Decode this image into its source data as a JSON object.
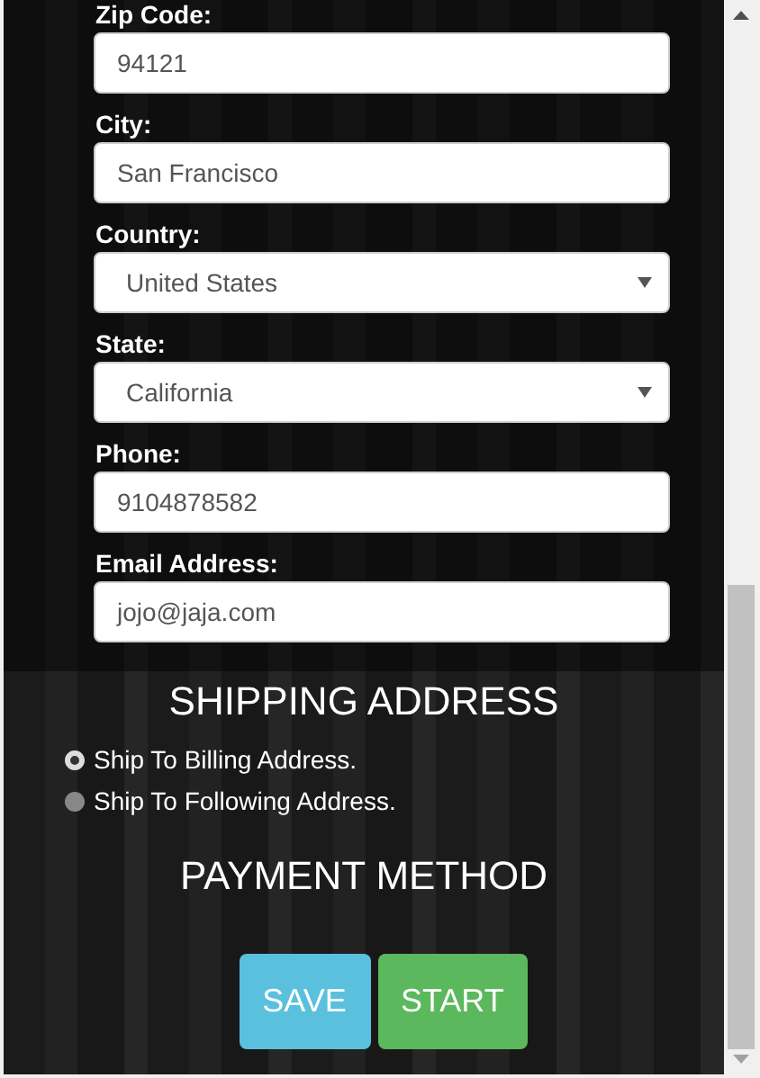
{
  "fields": [
    {
      "label": "Zip Code:",
      "kind": "text",
      "value": "94121"
    },
    {
      "label": "City:",
      "kind": "text",
      "value": "San Francisco"
    },
    {
      "label": "Country:",
      "kind": "select",
      "value": "United States"
    },
    {
      "label": "State:",
      "kind": "select",
      "value": "California"
    },
    {
      "label": "Phone:",
      "kind": "text",
      "value": "9104878582"
    },
    {
      "label": "Email Address:",
      "kind": "text",
      "value": "jojo@jaja.com"
    }
  ],
  "shipping": {
    "title": "SHIPPING ADDRESS",
    "options": [
      {
        "label": "Ship To Billing Address.",
        "selected": true
      },
      {
        "label": "Ship To Following Address.",
        "selected": false
      }
    ]
  },
  "payment": {
    "title": "PAYMENT METHOD"
  },
  "buttons": [
    {
      "label": "SAVE",
      "kind": "info"
    },
    {
      "label": "START",
      "kind": "success"
    }
  ]
}
